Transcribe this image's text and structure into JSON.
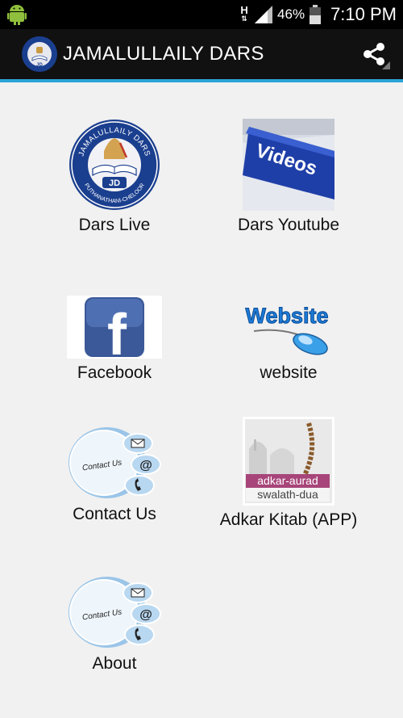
{
  "status_bar": {
    "network_type": "H",
    "battery_percent": "46%",
    "time": "7:10 PM",
    "icons": [
      "android-debug-icon",
      "signal-icon",
      "battery-icon"
    ]
  },
  "action_bar": {
    "title": "JAMALULLAILY DARS",
    "logo": {
      "top_text": "JAMALULLAILY DARS",
      "monogram": "JD",
      "bottom_text": "PUTHANATHANI-CHELOOR"
    },
    "share_icon": "share-icon",
    "accent_color": "#2aa3d6"
  },
  "grid": {
    "items": [
      {
        "label": "Dars Live",
        "icon": "jamalullaily-dars-logo"
      },
      {
        "label": "Dars Youtube",
        "icon": "videos-key-image",
        "image_text": "Videos"
      },
      {
        "label": "Facebook",
        "icon": "facebook-icon",
        "image_text": "f"
      },
      {
        "label": "website",
        "icon": "website-mouse-icon",
        "image_text": "Website"
      },
      {
        "label": "Contact Us",
        "icon": "contact-us-icon",
        "image_text": "Contact Us"
      },
      {
        "label": "Adkar Kitab (APP)",
        "icon": "adkar-kitab-image",
        "image_text_1": "adkar-aurad",
        "image_text_2": "swalath-dua"
      },
      {
        "label": "About",
        "icon": "contact-us-icon",
        "image_text": "Contact Us"
      }
    ]
  }
}
